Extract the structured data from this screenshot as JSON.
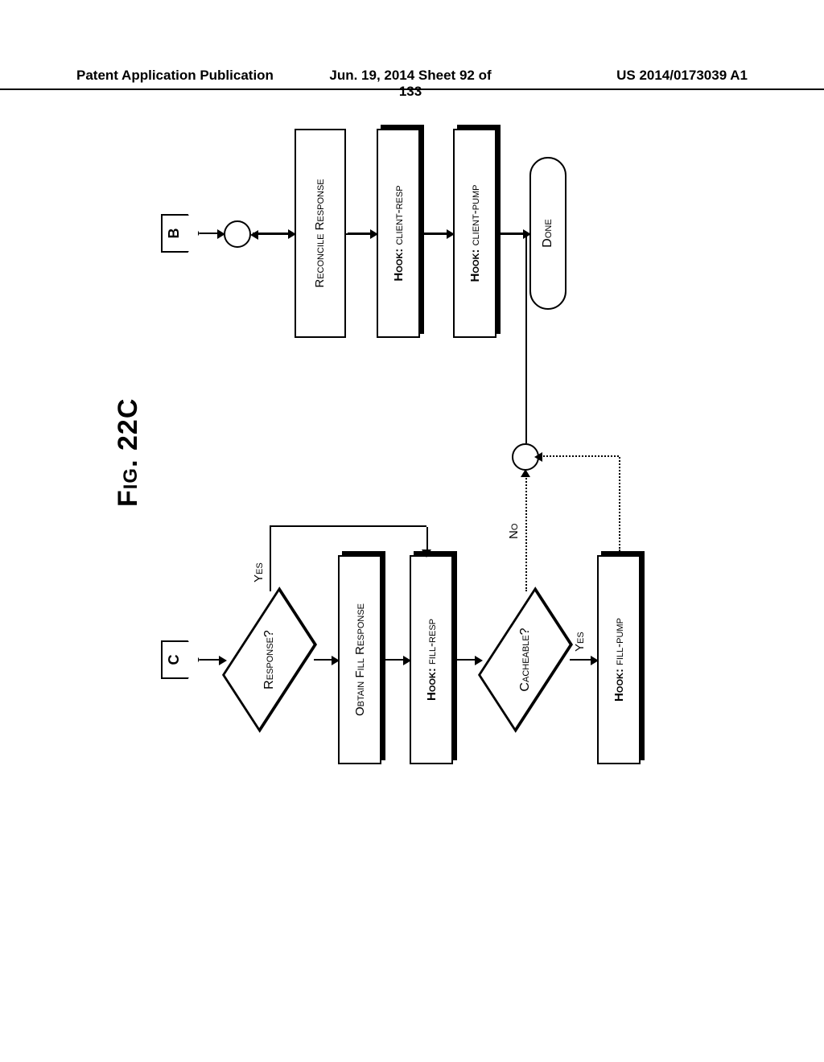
{
  "header": {
    "left": "Patent Application Publication",
    "middle": "Jun. 19, 2014  Sheet 92 of 133",
    "right": "US 2014/0173039 A1"
  },
  "figure": {
    "title": "Fig. 22C",
    "connectors": {
      "c": "C",
      "b": "B"
    },
    "decisions": {
      "response": "Response?",
      "cacheable": "Cacheable?"
    },
    "edges": {
      "yes": "Yes",
      "no": "No"
    },
    "process": {
      "obtain_fill_response": "Obtain Fill Response",
      "hook_fill_resp_prefix": "Hook:",
      "hook_fill_resp": "fill-resp",
      "hook_fill_pump_prefix": "Hook:",
      "hook_fill_pump": "fill-pump",
      "reconcile_response": "Reconcile Response",
      "hook_client_resp_prefix": "Hook:",
      "hook_client_resp": "client-resp",
      "hook_client_pump_prefix": "Hook:",
      "hook_client_pump": "client-pump"
    },
    "terminator": {
      "done": "Done"
    }
  }
}
